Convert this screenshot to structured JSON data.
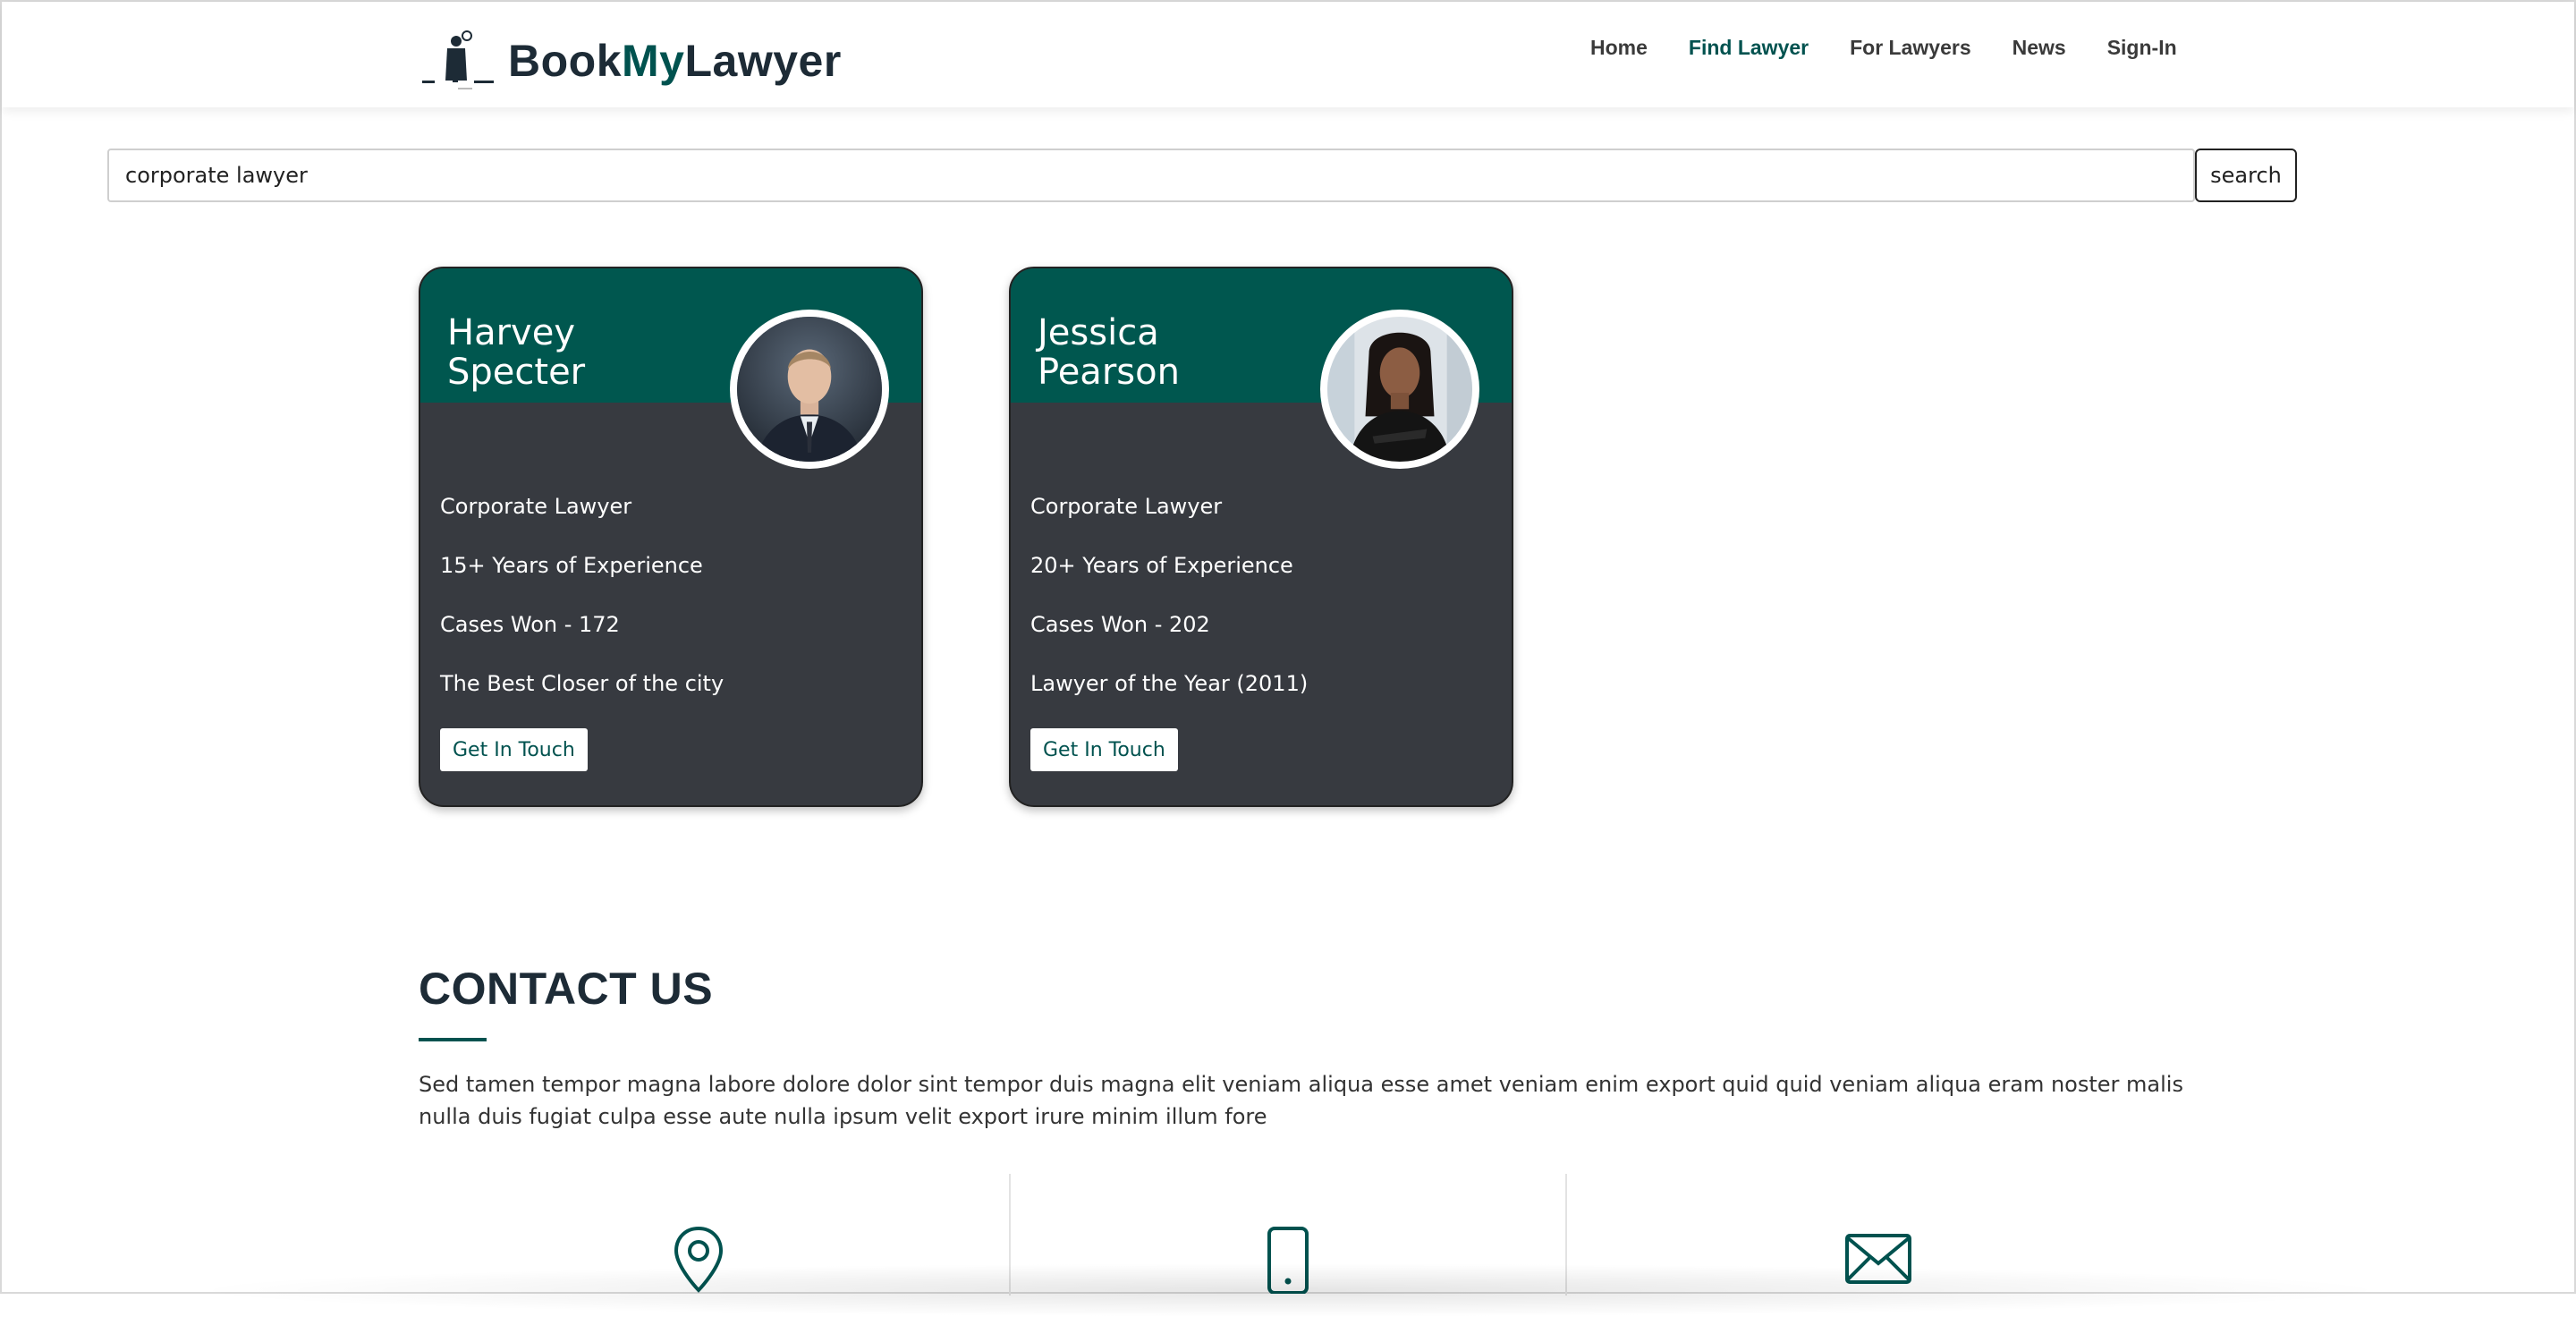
{
  "header": {
    "logo_book": "Book",
    "logo_my": "My",
    "logo_lawyer": "Lawyer",
    "nav": [
      {
        "label": "Home",
        "active": false
      },
      {
        "label": "Find Lawyer",
        "active": true
      },
      {
        "label": "For Lawyers",
        "active": false
      },
      {
        "label": "News",
        "active": false
      },
      {
        "label": "Sign-In",
        "active": false
      }
    ]
  },
  "search": {
    "value": "corporate lawyer",
    "clear_icon": "clear-circle-icon",
    "button_label": "search"
  },
  "lawyers": [
    {
      "first": "Harvey",
      "last": "Specter",
      "lines": [
        "Corporate Lawyer",
        "15+ Years of Experience",
        "Cases Won - 172",
        "The Best Closer of the city"
      ],
      "button": "Get In Touch"
    },
    {
      "first": "Jessica",
      "last": "Pearson",
      "lines": [
        "Corporate Lawyer",
        "20+ Years of Experience",
        "Cases Won - 202",
        "Lawyer of the Year (2011)"
      ],
      "button": "Get In Touch"
    }
  ],
  "contact": {
    "title": "CONTACT US",
    "description": "Sed tamen tempor magna labore dolore dolor sint tempor duis magna elit veniam aliqua esse amet veniam enim export quid quid veniam aliqua eram noster malis nulla duis fugiat culpa esse aute nulla ipsum velit export irure minim illum fore",
    "icons": [
      "location-pin-icon",
      "phone-icon",
      "envelope-icon"
    ]
  },
  "colors": {
    "brand_green": "#00524f",
    "card_dark": "#373a40",
    "text_dark": "#1d2b36"
  }
}
